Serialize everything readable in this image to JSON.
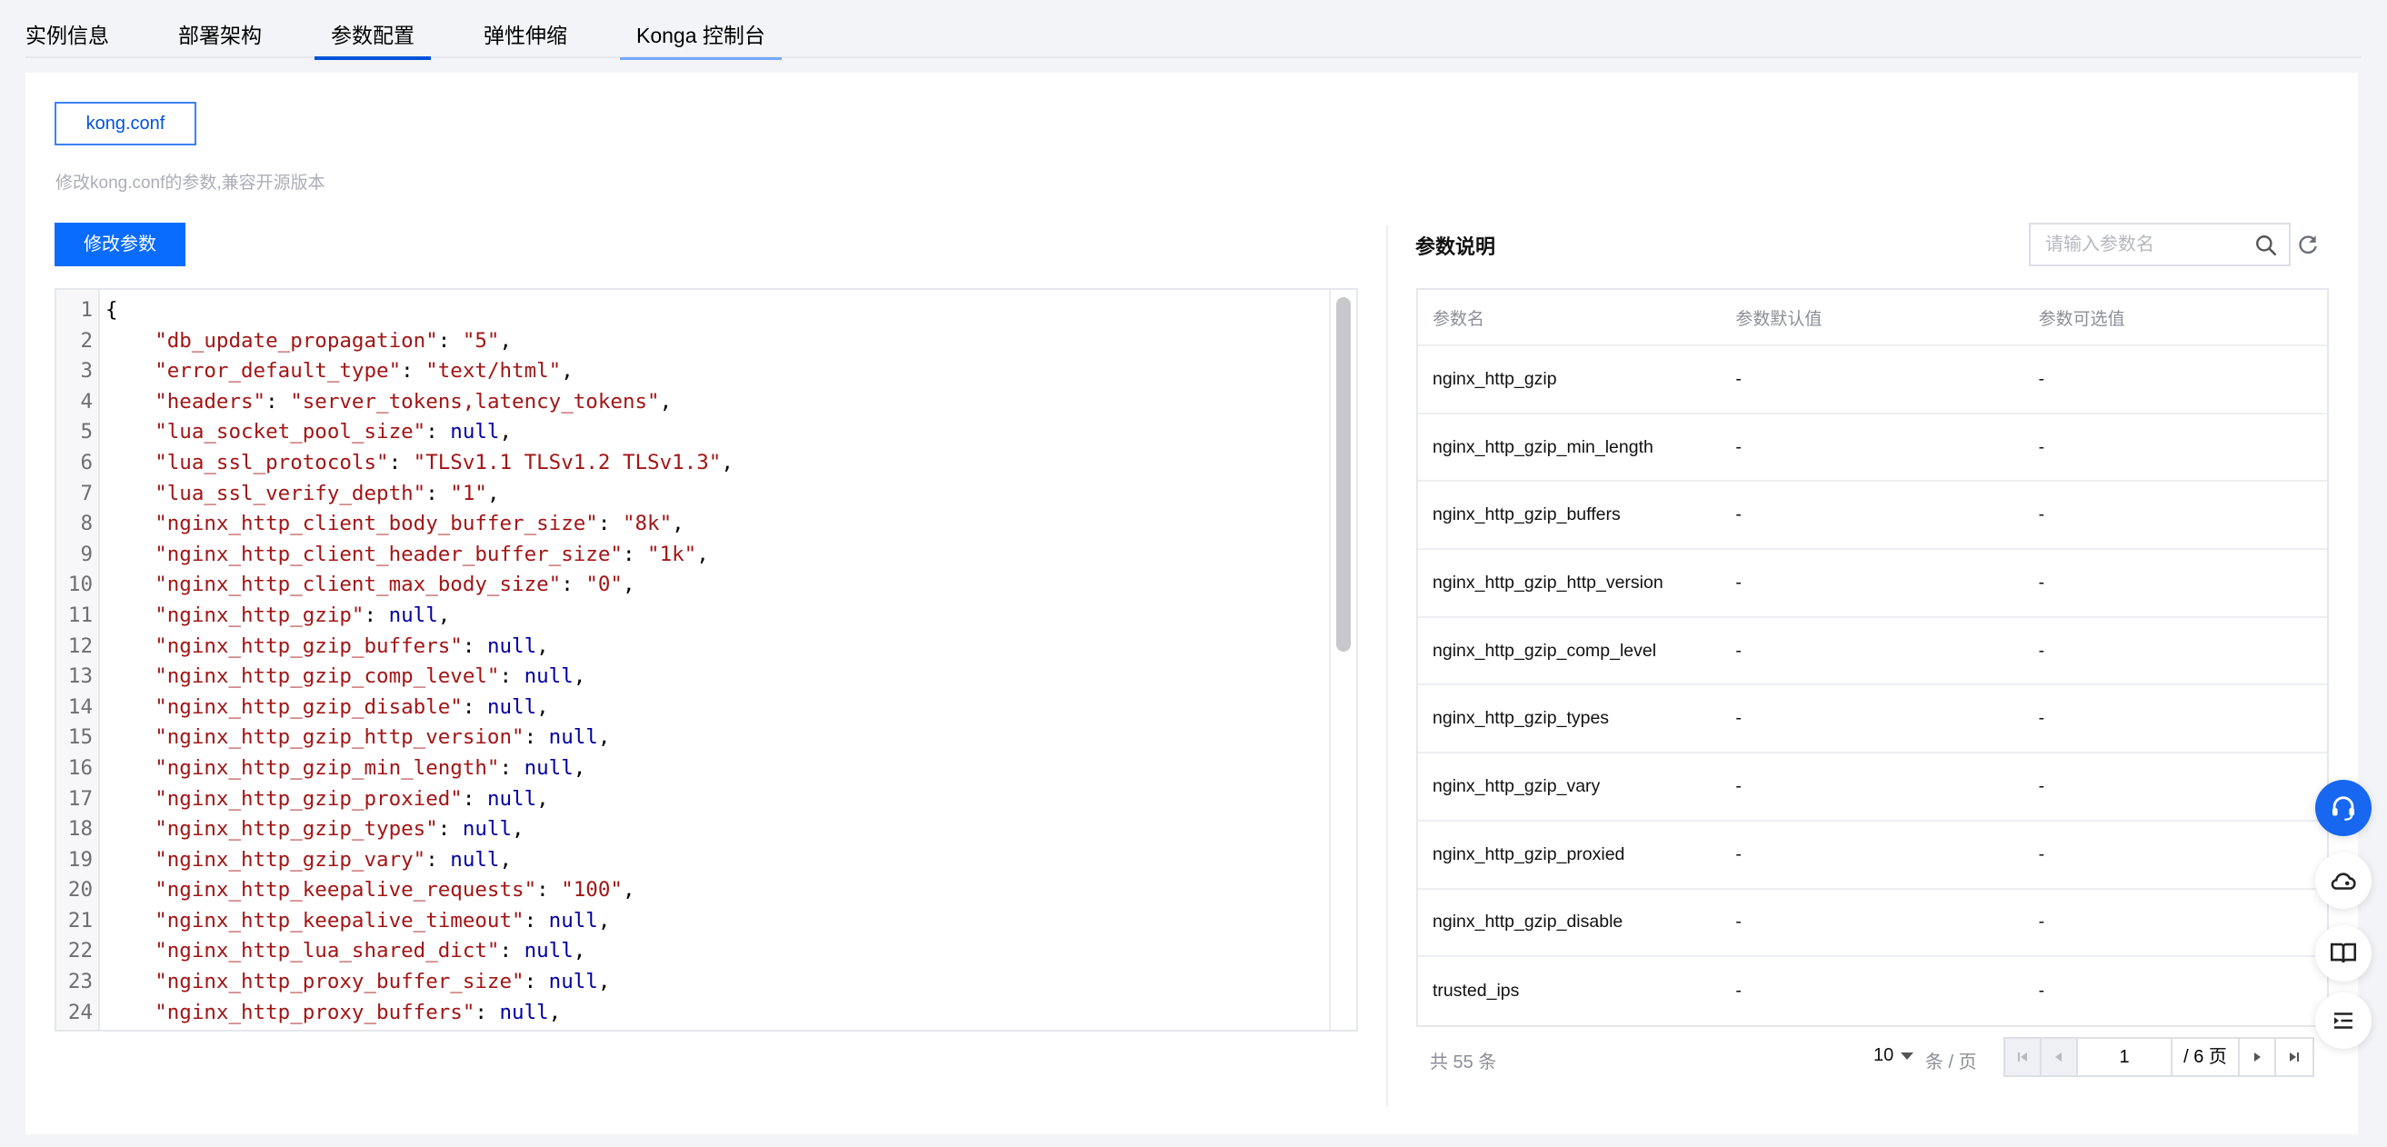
{
  "tabs": [
    {
      "label": "实例信息"
    },
    {
      "label": "部署架构"
    },
    {
      "label": "参数配置"
    },
    {
      "label": "弹性伸缩"
    },
    {
      "label": "Konga 控制台"
    }
  ],
  "config": {
    "file_tab": "kong.conf",
    "hint": "修改kong.conf的参数,兼容开源版本",
    "edit_button": "修改参数"
  },
  "editor": {
    "lines": [
      {
        "n": "1",
        "k": "",
        "v": "",
        "t": "open"
      },
      {
        "n": "2",
        "k": "\"db_update_propagation\"",
        "v": "\"5\"",
        "t": "str"
      },
      {
        "n": "3",
        "k": "\"error_default_type\"",
        "v": "\"text/html\"",
        "t": "str"
      },
      {
        "n": "4",
        "k": "\"headers\"",
        "v": "\"server_tokens,latency_tokens\"",
        "t": "str"
      },
      {
        "n": "5",
        "k": "\"lua_socket_pool_size\"",
        "v": "null",
        "t": "nul"
      },
      {
        "n": "6",
        "k": "\"lua_ssl_protocols\"",
        "v": "\"TLSv1.1 TLSv1.2 TLSv1.3\"",
        "t": "str"
      },
      {
        "n": "7",
        "k": "\"lua_ssl_verify_depth\"",
        "v": "\"1\"",
        "t": "str"
      },
      {
        "n": "8",
        "k": "\"nginx_http_client_body_buffer_size\"",
        "v": "\"8k\"",
        "t": "str"
      },
      {
        "n": "9",
        "k": "\"nginx_http_client_header_buffer_size\"",
        "v": "\"1k\"",
        "t": "str"
      },
      {
        "n": "10",
        "k": "\"nginx_http_client_max_body_size\"",
        "v": "\"0\"",
        "t": "str"
      },
      {
        "n": "11",
        "k": "\"nginx_http_gzip\"",
        "v": "null",
        "t": "nul"
      },
      {
        "n": "12",
        "k": "\"nginx_http_gzip_buffers\"",
        "v": "null",
        "t": "nul"
      },
      {
        "n": "13",
        "k": "\"nginx_http_gzip_comp_level\"",
        "v": "null",
        "t": "nul"
      },
      {
        "n": "14",
        "k": "\"nginx_http_gzip_disable\"",
        "v": "null",
        "t": "nul"
      },
      {
        "n": "15",
        "k": "\"nginx_http_gzip_http_version\"",
        "v": "null",
        "t": "nul"
      },
      {
        "n": "16",
        "k": "\"nginx_http_gzip_min_length\"",
        "v": "null",
        "t": "nul"
      },
      {
        "n": "17",
        "k": "\"nginx_http_gzip_proxied\"",
        "v": "null",
        "t": "nul"
      },
      {
        "n": "18",
        "k": "\"nginx_http_gzip_types\"",
        "v": "null",
        "t": "nul"
      },
      {
        "n": "19",
        "k": "\"nginx_http_gzip_vary\"",
        "v": "null",
        "t": "nul"
      },
      {
        "n": "20",
        "k": "\"nginx_http_keepalive_requests\"",
        "v": "\"100\"",
        "t": "str"
      },
      {
        "n": "21",
        "k": "\"nginx_http_keepalive_timeout\"",
        "v": "null",
        "t": "nul"
      },
      {
        "n": "22",
        "k": "\"nginx_http_lua_shared_dict\"",
        "v": "null",
        "t": "nul"
      },
      {
        "n": "23",
        "k": "\"nginx_http_proxy_buffer_size\"",
        "v": "null",
        "t": "nul"
      },
      {
        "n": "24",
        "k": "\"nginx_http_proxy_buffers\"",
        "v": "null",
        "t": "nul"
      }
    ]
  },
  "params": {
    "title": "参数说明",
    "search_placeholder": "请输入参数名",
    "columns": [
      "参数名",
      "参数默认值",
      "参数可选值"
    ],
    "rows": [
      [
        "nginx_http_gzip",
        "-",
        "-"
      ],
      [
        "nginx_http_gzip_min_length",
        "-",
        "-"
      ],
      [
        "nginx_http_gzip_buffers",
        "-",
        "-"
      ],
      [
        "nginx_http_gzip_http_version",
        "-",
        "-"
      ],
      [
        "nginx_http_gzip_comp_level",
        "-",
        "-"
      ],
      [
        "nginx_http_gzip_types",
        "-",
        "-"
      ],
      [
        "nginx_http_gzip_vary",
        "-",
        "-"
      ],
      [
        "nginx_http_gzip_proxied",
        "-",
        "-"
      ],
      [
        "nginx_http_gzip_disable",
        "-",
        "-"
      ],
      [
        "trusted_ips",
        "-",
        "-"
      ]
    ]
  },
  "pagination": {
    "total": "共 55 条",
    "page_size": "10",
    "per_page": "条 / 页",
    "current_page": "1",
    "total_pages": "/ 6 页"
  },
  "float_icons": [
    "headset-icon",
    "cloud-user-icon",
    "book-icon",
    "list-indent-icon"
  ],
  "colors": {
    "accent": "#0a6cff",
    "code_string": "#a31515",
    "code_null": "#0000a3"
  }
}
